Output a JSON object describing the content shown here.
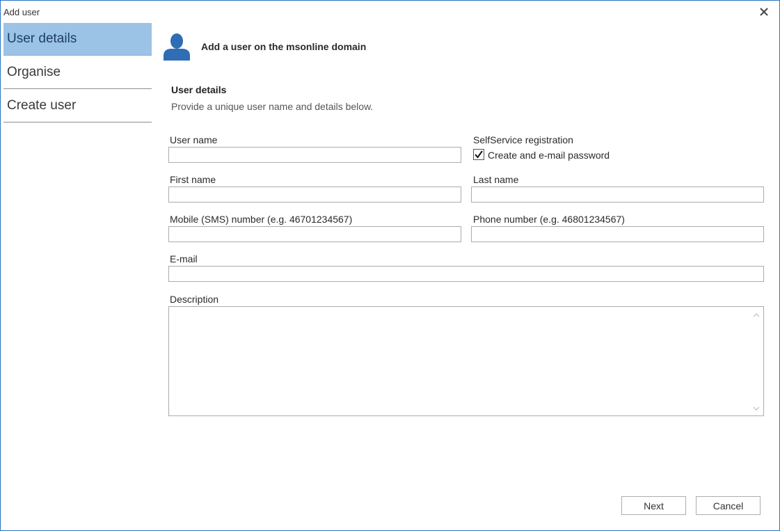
{
  "window": {
    "title": "Add user",
    "close_icon": "close-icon"
  },
  "sidebar": {
    "items": [
      {
        "label": "User details",
        "active": true
      },
      {
        "label": "Organise",
        "active": false
      },
      {
        "label": "Create user",
        "active": false
      }
    ]
  },
  "header": {
    "title": "Add a user on the msonline domain",
    "icon": "user-icon"
  },
  "section": {
    "title": "User details",
    "description": "Provide a unique user name and details below."
  },
  "form": {
    "username": {
      "label": "User name",
      "value": ""
    },
    "selfservice": {
      "label": "SelfService registration",
      "checkbox_label": "Create and e-mail password",
      "checked": true
    },
    "first_name": {
      "label": "First name",
      "value": ""
    },
    "last_name": {
      "label": "Last name",
      "value": ""
    },
    "mobile": {
      "label": "Mobile (SMS) number (e.g. 46701234567)",
      "value": ""
    },
    "phone": {
      "label": "Phone number (e.g. 46801234567)",
      "value": ""
    },
    "email": {
      "label": "E-mail",
      "value": ""
    },
    "description": {
      "label": "Description",
      "value": ""
    }
  },
  "buttons": {
    "next": "Next",
    "cancel": "Cancel"
  },
  "colors": {
    "accent": "#2b73c5",
    "active_nav": "#9ac3e6",
    "icon": "#2f6db5"
  }
}
